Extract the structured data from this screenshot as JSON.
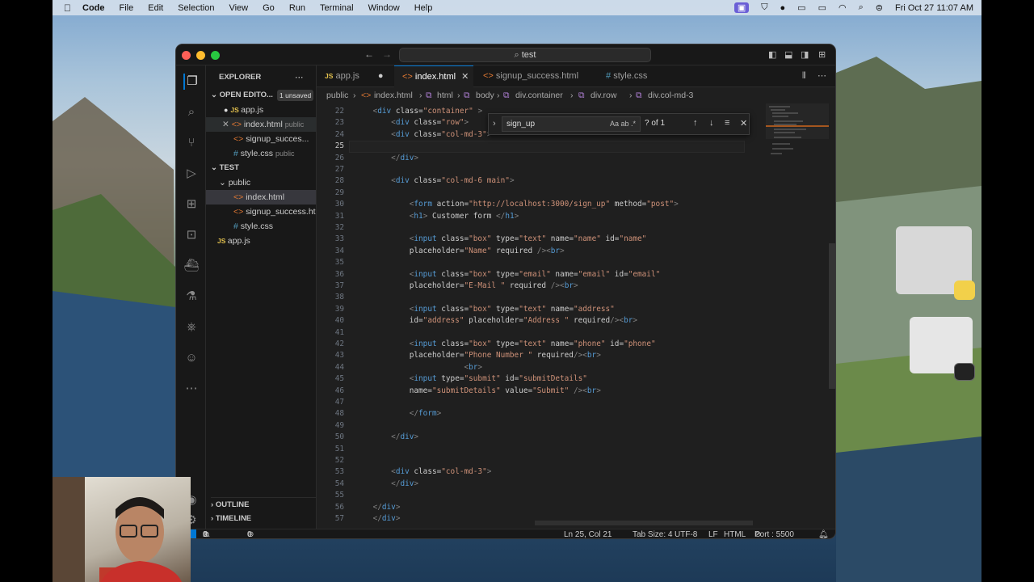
{
  "menubar": {
    "app": "Code",
    "menus": [
      "File",
      "Edit",
      "Selection",
      "View",
      "Go",
      "Run",
      "Terminal",
      "Window",
      "Help"
    ],
    "clock": "Fri Oct 27  11:07 AM"
  },
  "window": {
    "search": "test"
  },
  "sidebar": {
    "title": "EXPLORER",
    "open_editors": {
      "label": "OPEN EDITO...",
      "badge": "1 unsaved",
      "items": [
        {
          "label": "app.js",
          "desc": "",
          "icon": "js"
        },
        {
          "label": "index.html",
          "desc": "public",
          "icon": "html"
        },
        {
          "label": "signup_succes...",
          "desc": "",
          "icon": "html"
        },
        {
          "label": "style.css",
          "desc": "public",
          "icon": "css"
        }
      ]
    },
    "folder": {
      "label": "TEST",
      "sub": "public",
      "items": [
        "index.html",
        "signup_success.ht...",
        "style.css"
      ],
      "root_file": "app.js"
    },
    "outline": "OUTLINE",
    "timeline": "TIMELINE"
  },
  "tabs": [
    {
      "label": "app.js",
      "icon": "JS"
    },
    {
      "label": "index.html",
      "icon": "<>"
    },
    {
      "label": "signup_success.html",
      "icon": "<>"
    },
    {
      "label": "style.css",
      "icon": "#"
    }
  ],
  "breadcrumbs": [
    "public",
    "index.html",
    "html",
    "body",
    "div.container",
    "div.row",
    "div.col-md-3"
  ],
  "find": {
    "query": "sign_up",
    "options": "Aa  ab  .*",
    "result": "? of 1"
  },
  "code": {
    "lines": [
      {
        "n": "22",
        "t": "    <div class=\"container\" >"
      },
      {
        "n": "23",
        "t": "        <div class=\"row\">"
      },
      {
        "n": "24",
        "t": "        <div class=\"col-md-3\">"
      },
      {
        "n": "25",
        "t": "                "
      },
      {
        "n": "26",
        "t": "        </div>"
      },
      {
        "n": "27",
        "t": ""
      },
      {
        "n": "28",
        "t": "        <div class=\"col-md-6 main\">"
      },
      {
        "n": "29",
        "t": ""
      },
      {
        "n": "30",
        "t": "            <form action=\"http://localhost:3000/sign_up\" method=\"post\">"
      },
      {
        "n": "31",
        "t": "            <h1> Customer form </h1>"
      },
      {
        "n": "32",
        "t": ""
      },
      {
        "n": "33",
        "t": "            <input class=\"box\" type=\"text\" name=\"name\" id=\"name\""
      },
      {
        "n": "34",
        "t": "            placeholder=\"Name\" required /><br>"
      },
      {
        "n": "35",
        "t": ""
      },
      {
        "n": "36",
        "t": "            <input class=\"box\" type=\"email\" name=\"email\" id=\"email\""
      },
      {
        "n": "37",
        "t": "            placeholder=\"E-Mail \" required /><br>"
      },
      {
        "n": "38",
        "t": ""
      },
      {
        "n": "39",
        "t": "            <input class=\"box\" type=\"text\" name=\"address\""
      },
      {
        "n": "40",
        "t": "            id=\"address\" placeholder=\"Address \" required/><br>"
      },
      {
        "n": "41",
        "t": ""
      },
      {
        "n": "42",
        "t": "            <input class=\"box\" type=\"text\" name=\"phone\" id=\"phone\""
      },
      {
        "n": "43",
        "t": "            placeholder=\"Phone Number \" required/><br>"
      },
      {
        "n": "44",
        "t": "                        <br>"
      },
      {
        "n": "45",
        "t": "            <input type=\"submit\" id=\"submitDetails\""
      },
      {
        "n": "46",
        "t": "            name=\"submitDetails\" value=\"Submit\" /><br>"
      },
      {
        "n": "47",
        "t": ""
      },
      {
        "n": "48",
        "t": "            </form>"
      },
      {
        "n": "49",
        "t": ""
      },
      {
        "n": "50",
        "t": "        </div>"
      },
      {
        "n": "51",
        "t": ""
      },
      {
        "n": "52",
        "t": ""
      },
      {
        "n": "53",
        "t": "        <div class=\"col-md-3\">"
      },
      {
        "n": "54",
        "t": "        </div>"
      },
      {
        "n": "55",
        "t": ""
      },
      {
        "n": "56",
        "t": "    </div>"
      },
      {
        "n": "57",
        "t": "    </div>"
      }
    ],
    "active_line": "25"
  },
  "statusbar": {
    "errors": "0",
    "warnings": "0",
    "ports": "0",
    "position": "Ln 25, Col 21",
    "tabsize": "Tab Size: 4",
    "encoding": "UTF-8",
    "eol": "LF",
    "language": "HTML",
    "port": "Port : 5500"
  },
  "colors": {
    "tag": "#569cd6",
    "attr": "#9cdcfe",
    "string": "#ce9178",
    "accent": "#0078d4"
  }
}
